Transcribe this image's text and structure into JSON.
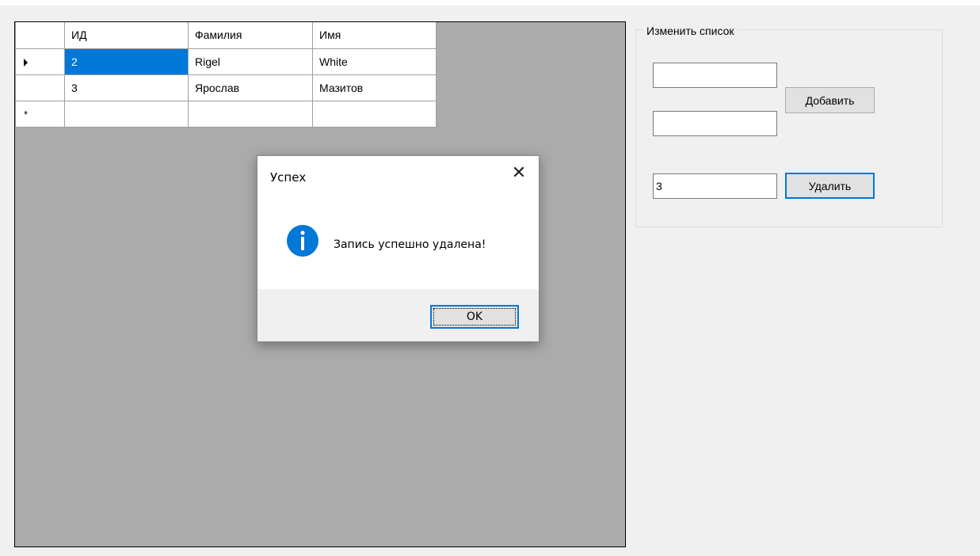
{
  "grid": {
    "columns": [
      "ИД",
      "Фамилия",
      "Имя"
    ],
    "rows": [
      {
        "id": "2",
        "fam": "Rigel",
        "name": "White"
      },
      {
        "id": "3",
        "fam": "Ярослав",
        "name": "Мазитов"
      }
    ],
    "new_row_marker": "*"
  },
  "edit_group": {
    "title": "Изменить список",
    "field1_value": "",
    "field2_value": "",
    "add_label": "Добавить",
    "delete_field_value": "3",
    "delete_label": "Удалить"
  },
  "dialog": {
    "title": "Успех",
    "close_glyph": "✕",
    "message": "Запись успешно удалена!",
    "ok_label": "OK",
    "icon": "info-icon"
  },
  "colors": {
    "selection": "#0078d7",
    "form_background": "#f0f0f0",
    "grid_background": "#ababab"
  }
}
